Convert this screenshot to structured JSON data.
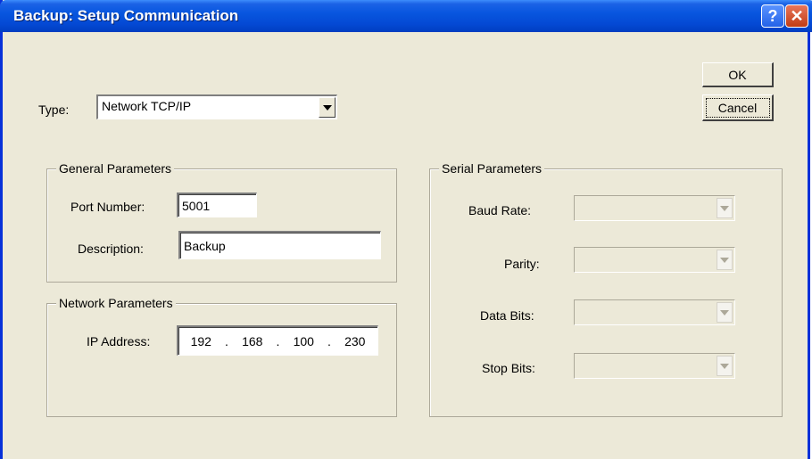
{
  "window": {
    "title": "Backup: Setup Communication"
  },
  "titlebar": {
    "help_glyph": "?",
    "close_glyph": "✕"
  },
  "buttons": {
    "ok": "OK",
    "cancel": "Cancel"
  },
  "type": {
    "label": "Type:",
    "value": "Network TCP/IP"
  },
  "general": {
    "title": "General Parameters",
    "port_label": "Port Number:",
    "port_value": "5001",
    "desc_label": "Description:",
    "desc_value": "Backup"
  },
  "network": {
    "title": "Network Parameters",
    "ip_label": "IP Address:",
    "ip": [
      "192",
      "168",
      "100",
      "230"
    ]
  },
  "serial": {
    "title": "Serial Parameters",
    "baud_label": "Baud Rate:",
    "parity_label": "Parity:",
    "databits_label": "Data Bits:",
    "stopbits_label": "Stop Bits:"
  },
  "colors": {
    "title_bar": "#0856df",
    "dialog_bg": "#ece9d8",
    "close_button": "#c13c15"
  }
}
